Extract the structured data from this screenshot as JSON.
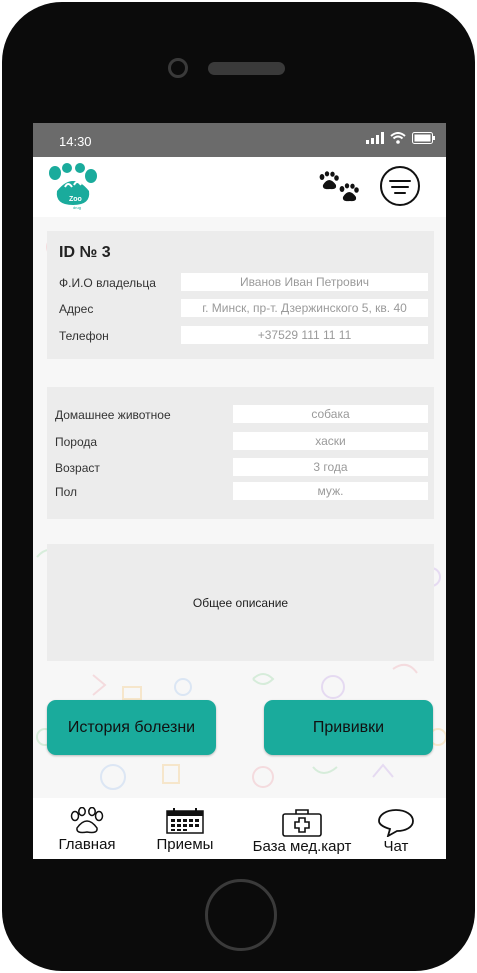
{
  "status": {
    "time": "14:30"
  },
  "owner": {
    "id_label": "ID № 3",
    "fields": [
      {
        "label": "Ф.И.О владельца",
        "value": "Иванов Иван Петрович"
      },
      {
        "label": "Адрес",
        "value": "г. Минск, пр-т. Дзержинского 5, кв. 40"
      },
      {
        "label": "Телефон",
        "value": "+37529 111 11 11"
      }
    ]
  },
  "pet": {
    "fields": [
      {
        "label": "Домашнее животное",
        "value": "собака"
      },
      {
        "label": "Порода",
        "value": "хаски"
      },
      {
        "label": "Возраст",
        "value": "3 года"
      },
      {
        "label": "Пол",
        "value": "муж."
      }
    ]
  },
  "description": {
    "label": "Общее описание"
  },
  "buttons": {
    "history": "История болезни",
    "vaccinations": "Прививки"
  },
  "tabs": [
    {
      "label": "Главная",
      "icon": "paw-icon"
    },
    {
      "label": "Приемы",
      "icon": "calendar-icon"
    },
    {
      "label": "База мед.карт",
      "icon": "medkit-icon"
    },
    {
      "label": "Чат",
      "icon": "chat-bubble-icon"
    }
  ],
  "logo": {
    "text": "Zoo",
    "subtext": "drug"
  },
  "colors": {
    "accent": "#1aab9c",
    "statusbar": "#6b6b6b",
    "card": "#ececec"
  }
}
